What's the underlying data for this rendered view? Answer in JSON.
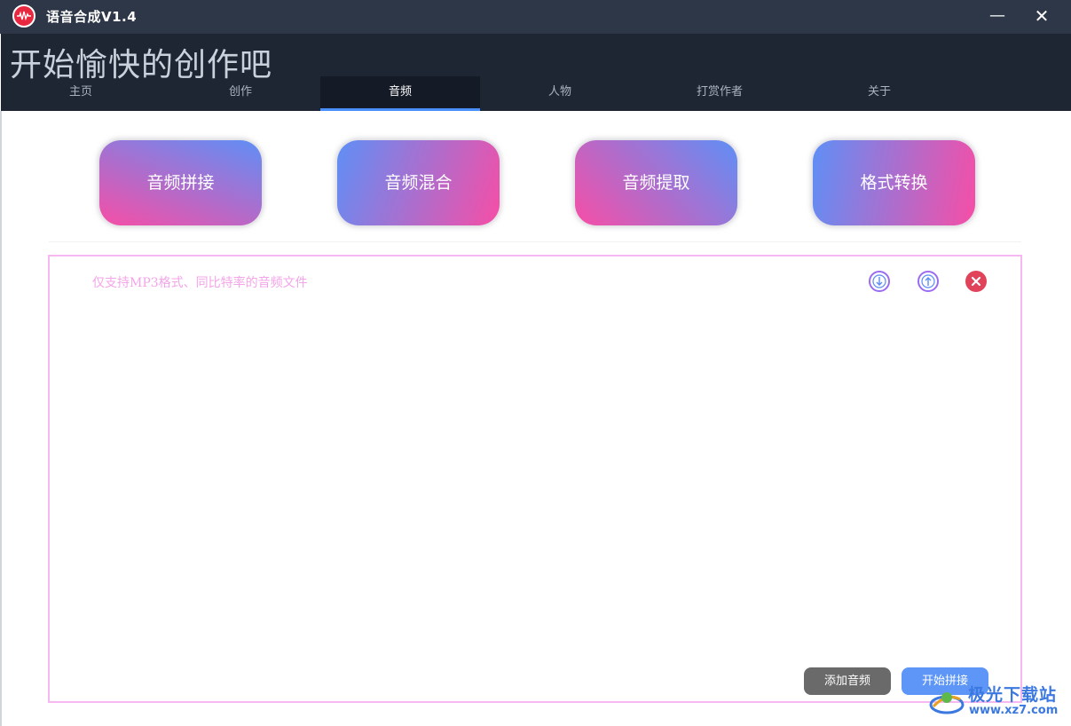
{
  "window": {
    "title": "语音合成V1.4",
    "minimize": "—",
    "close": "✕",
    "icon": "app-waveform-icon"
  },
  "header": {
    "slogan": "开始愉快的创作吧",
    "tabs": [
      {
        "label": "主页"
      },
      {
        "label": "创作"
      },
      {
        "label": "音频",
        "active": true
      },
      {
        "label": "人物"
      },
      {
        "label": "打赏作者"
      },
      {
        "label": "关于"
      }
    ]
  },
  "features": [
    {
      "label": "音频拼接"
    },
    {
      "label": "音频混合"
    },
    {
      "label": "音频提取"
    },
    {
      "label": "格式转换"
    }
  ],
  "panel": {
    "hint": "仅支持MP3格式、同比特率的音频文件",
    "icons": [
      "move-down-icon",
      "move-up-icon",
      "delete-icon"
    ],
    "add_label": "添加音频",
    "start_label": "开始拼接"
  },
  "watermark": {
    "title": "极光下载站",
    "url": "www.xz7.com"
  },
  "colors": {
    "titlebar": "#2d3747",
    "header": "#1f2633",
    "tab_active_indicator": "#4a8fff",
    "gradient_blue": "#5f8ff6",
    "gradient_pink": "#f64ea6",
    "panel_border": "#f7b7f0",
    "delete_red": "#e0435a"
  }
}
